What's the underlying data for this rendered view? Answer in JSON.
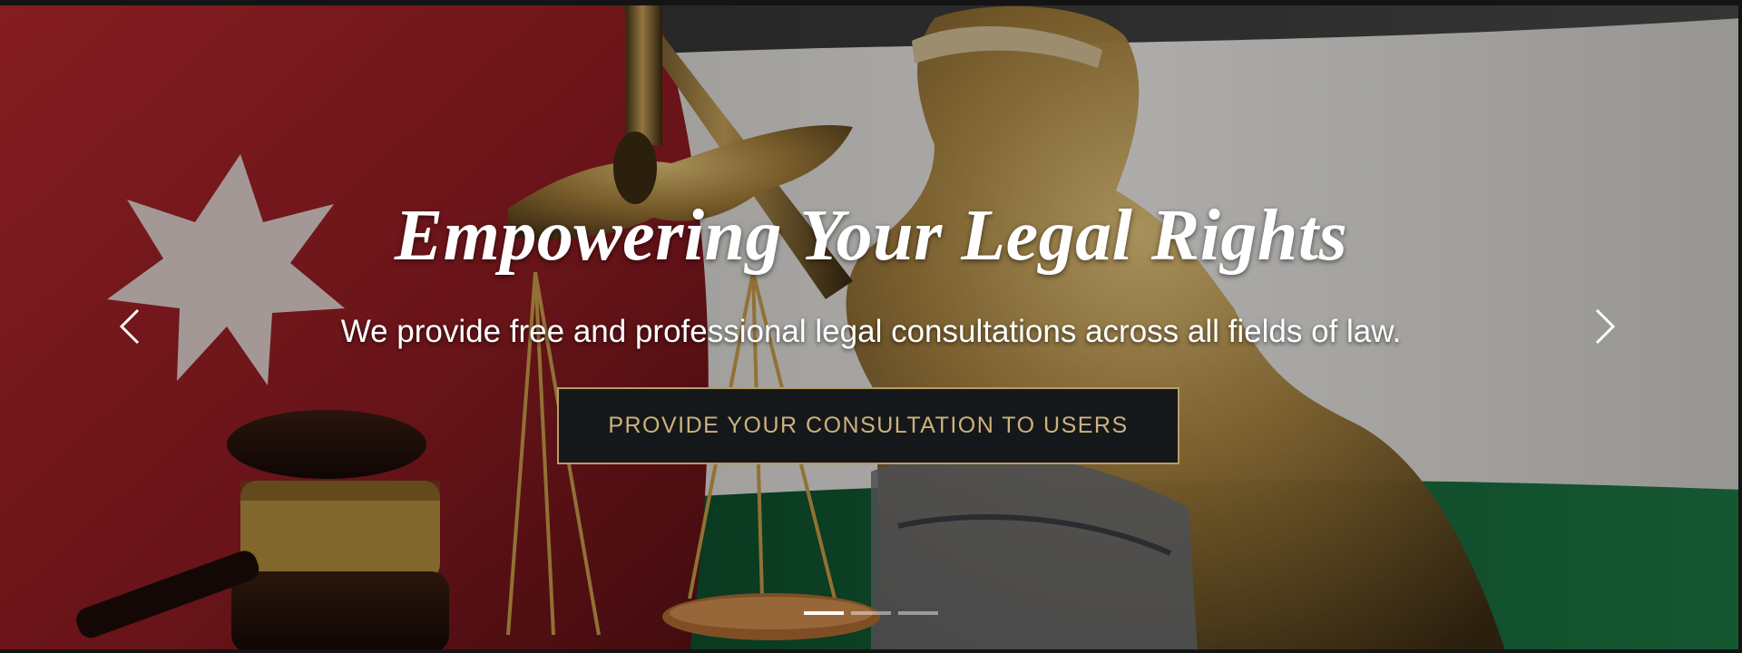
{
  "hero": {
    "title": "Empowering Your Legal Rights",
    "subtitle": "We provide free and professional legal consultations across all fields of law.",
    "cta_label": "PROVIDE YOUR CONSULTATION TO USERS"
  },
  "carousel": {
    "prev_icon": "chevron-left-icon",
    "next_icon": "chevron-right-icon",
    "slide_count": 3,
    "active_index": 0
  },
  "colors": {
    "accent_gold": "#b79d66",
    "button_bg": "#15181b",
    "text_white": "#ffffff"
  }
}
